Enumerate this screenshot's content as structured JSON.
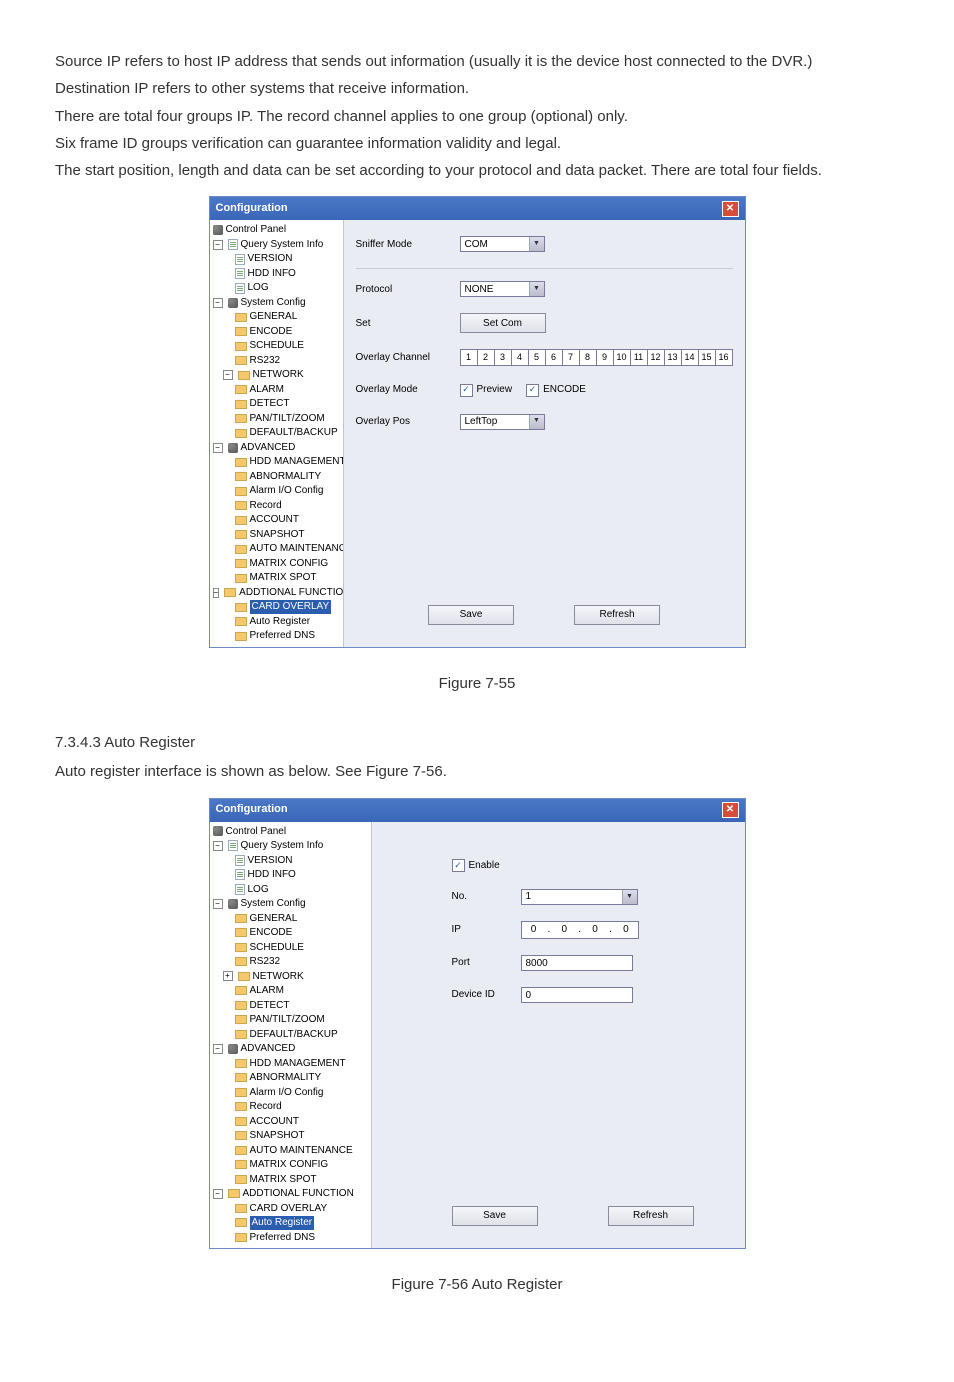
{
  "paragraphs": {
    "p1": "Source IP refers to host IP address that sends out information (usually it is the device host connected to the DVR.)",
    "p2": "Destination IP refers to other systems that receive information.",
    "p3": "There are total four groups IP. The record channel applies to one group (optional) only.",
    "p4": "Six frame ID groups verification can guarantee information validity and legal.",
    "p5": "The start position, length and data can be set according to your protocol and data packet. There are total four fields."
  },
  "window1": {
    "title": "Configuration",
    "tree": {
      "l0": "Control Panel",
      "l1": "Query System Info",
      "l1a": "VERSION",
      "l1b": "HDD INFO",
      "l1c": "LOG",
      "l2": "System Config",
      "l2a": "GENERAL",
      "l2b": "ENCODE",
      "l2c": "SCHEDULE",
      "l2d": "RS232",
      "l2e": "NETWORK",
      "l2f": "ALARM",
      "l2g": "DETECT",
      "l2h": "PAN/TILT/ZOOM",
      "l2i": "DEFAULT/BACKUP",
      "l3": "ADVANCED",
      "l3a": "HDD MANAGEMENT",
      "l3b": "ABNORMALITY",
      "l3c": "Alarm I/O Config",
      "l3d": "Record",
      "l3e": "ACCOUNT",
      "l3f": "SNAPSHOT",
      "l3g": "AUTO MAINTENANCE",
      "l3h": "MATRIX CONFIG",
      "l3i": "MATRIX SPOT",
      "l4": "ADDTIONAL FUNCTION",
      "l4a": "CARD OVERLAY",
      "l4b": "Auto Register",
      "l4c": "Preferred DNS"
    },
    "panel": {
      "sniffer_mode_label": "Sniffer Mode",
      "sniffer_mode_value": "COM",
      "protocol_label": "Protocol",
      "protocol_value": "NONE",
      "set_label": "Set",
      "set_button": "Set Com",
      "overlay_channel_label": "Overlay Channel",
      "channels": [
        "1",
        "2",
        "3",
        "4",
        "5",
        "6",
        "7",
        "8",
        "9",
        "10",
        "11",
        "12",
        "13",
        "14",
        "15",
        "16"
      ],
      "overlay_mode_label": "Overlay Mode",
      "preview_label": "Preview",
      "encode_label": "ENCODE",
      "overlay_pos_label": "Overlay Pos",
      "overlay_pos_value": "LeftTop",
      "save": "Save",
      "refresh": "Refresh"
    }
  },
  "figure1_caption": "Figure 7-55",
  "section_heading": "7.3.4.3  Auto Register",
  "section_text": "Auto register interface is shown as below. See Figure 7-56.",
  "window2": {
    "title": "Configuration",
    "tree": {
      "l0": "Control Panel",
      "l1": "Query System Info",
      "l1a": "VERSION",
      "l1b": "HDD INFO",
      "l1c": "LOG",
      "l2": "System Config",
      "l2a": "GENERAL",
      "l2b": "ENCODE",
      "l2c": "SCHEDULE",
      "l2d": "RS232",
      "l2e": "NETWORK",
      "l2f": "ALARM",
      "l2g": "DETECT",
      "l2h": "PAN/TILT/ZOOM",
      "l2i": "DEFAULT/BACKUP",
      "l3": "ADVANCED",
      "l3a": "HDD MANAGEMENT",
      "l3b": "ABNORMALITY",
      "l3c": "Alarm I/O Config",
      "l3d": "Record",
      "l3e": "ACCOUNT",
      "l3f": "SNAPSHOT",
      "l3g": "AUTO MAINTENANCE",
      "l3h": "MATRIX CONFIG",
      "l3i": "MATRIX SPOT",
      "l4": "ADDTIONAL FUNCTION",
      "l4a": "CARD OVERLAY",
      "l4b": "Auto Register",
      "l4c": "Preferred DNS"
    },
    "panel": {
      "enable_label": "Enable",
      "no_label": "No.",
      "no_value": "1",
      "ip_label": "IP",
      "ip_value": [
        "0",
        "0",
        "0",
        "0"
      ],
      "port_label": "Port",
      "port_value": "8000",
      "deviceid_label": "Device ID",
      "deviceid_value": "0",
      "save": "Save",
      "refresh": "Refresh"
    }
  },
  "figure2_caption": "Figure 7-56 Auto Register"
}
